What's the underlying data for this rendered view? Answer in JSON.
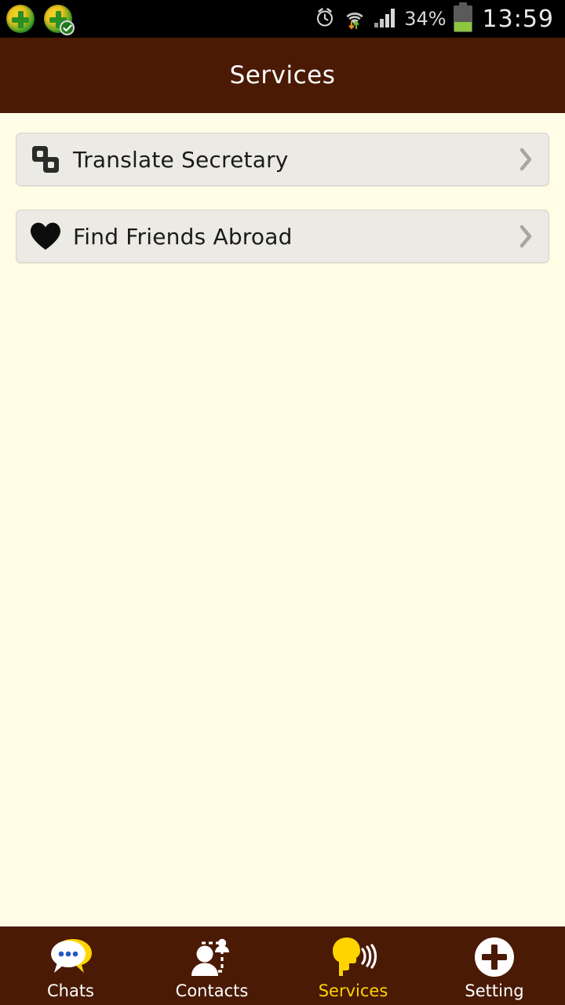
{
  "statusbar": {
    "left_icons": [
      {
        "name": "app-update-icon",
        "badge": false
      },
      {
        "name": "app-update-done-icon",
        "badge": true
      }
    ],
    "alarm_icon": "alarm-icon",
    "wifi_icon": "wifi-icon",
    "signal_icon": "cellular-signal-icon",
    "battery_percent": "34%",
    "battery_icon": "battery-icon",
    "battery_level": 34,
    "clock": "13:59"
  },
  "header": {
    "title": "Services"
  },
  "main": {
    "services": [
      {
        "label": "Translate Secretary",
        "icon": "overlapping-squares-icon",
        "chevron": "chevron-right-icon"
      },
      {
        "label": "Find Friends Abroad",
        "icon": "heart-icon",
        "chevron": "chevron-right-icon"
      }
    ]
  },
  "bottom_nav": {
    "active_color": "#FFD400",
    "inactive_color": "#FFFFFF",
    "items": [
      {
        "label": "Chats",
        "icon": "chat-bubble-icon",
        "active": false
      },
      {
        "label": "Contacts",
        "icon": "contacts-icon",
        "active": false
      },
      {
        "label": "Services",
        "icon": "speaking-head-icon",
        "active": true
      },
      {
        "label": "Setting",
        "icon": "plus-circle-icon",
        "active": false
      }
    ]
  },
  "colors": {
    "header_brown": "#4A1A05",
    "page_cream": "#FFFDE6",
    "row_gray": "#ECEAE4",
    "accent_yellow": "#FFD400"
  }
}
